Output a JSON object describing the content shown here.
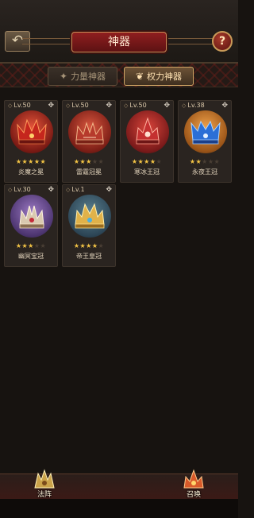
{
  "header": {
    "back_icon": "back-arrow-icon",
    "title": "神器",
    "help_label": "?"
  },
  "tabs": [
    {
      "label": "力量神器",
      "icon": "sparkle-icon",
      "active": false
    },
    {
      "label": "权力神器",
      "icon": "wing-icon",
      "active": true
    }
  ],
  "artifacts": [
    {
      "level": "Lv.50",
      "name": "炎魔之冕",
      "stars": 5,
      "max_stars": 5,
      "color": "#b8322a"
    },
    {
      "level": "Lv.50",
      "name": "雷霆冠冕",
      "stars": 3,
      "max_stars": 5,
      "color": "#a3362e"
    },
    {
      "level": "Lv.50",
      "name": "寒冰王冠",
      "stars": 4,
      "max_stars": 5,
      "color": "#9e2d2d"
    },
    {
      "level": "Lv.38",
      "name": "永夜王冠",
      "stars": 2,
      "max_stars": 5,
      "color": "#c07a2a"
    },
    {
      "level": "Lv.30",
      "name": "幽冥宝冠",
      "stars": 3,
      "max_stars": 5,
      "color": "#6c4a8a"
    },
    {
      "level": "Lv.1",
      "name": "帝王皇冠",
      "stars": 4,
      "max_stars": 5,
      "color": "#3d5c6e"
    }
  ],
  "bottom_nav": [
    {
      "label": "法阵",
      "icon": "array-icon"
    },
    {
      "label": "召唤",
      "icon": "summon-icon"
    }
  ]
}
